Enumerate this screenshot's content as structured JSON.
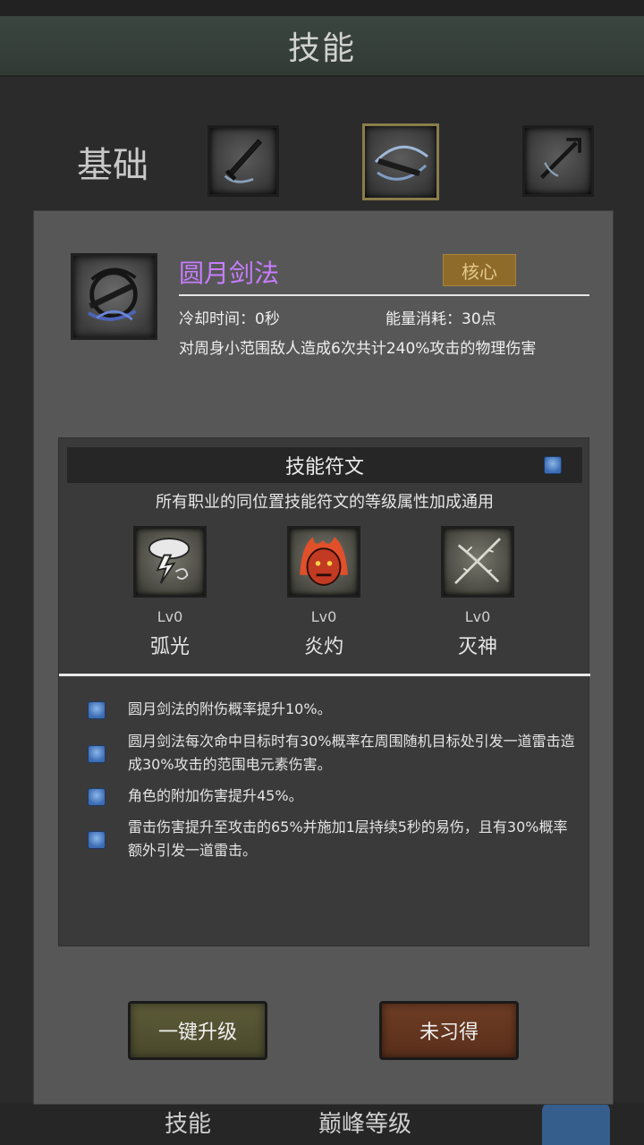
{
  "header": {
    "title": "技能"
  },
  "category": {
    "label": "基础"
  },
  "top_slots": [
    {
      "icon": "dagger-slash-icon",
      "selected": false
    },
    {
      "icon": "crescent-sword-icon",
      "selected": true
    },
    {
      "icon": "trident-spear-icon",
      "selected": false
    }
  ],
  "skill": {
    "name": "圆月剑法",
    "badge": "核心",
    "cooldown": "冷却时间：0秒",
    "energy": "能量消耗：30点",
    "description": "对周身小范围敌人造成6次共计240%攻击的物理伤害",
    "name_color": "#c77dff"
  },
  "runes": {
    "title": "技能符文",
    "subtitle": "所有职业的同位置技能符文的等级属性加成通用",
    "items": [
      {
        "icon": "storm-cloud-icon",
        "level": "Lv0",
        "name": "弧光"
      },
      {
        "icon": "fire-demon-icon",
        "level": "Lv0",
        "name": "炎灼"
      },
      {
        "icon": "thorn-vine-icon",
        "level": "Lv0",
        "name": "灭神"
      }
    ],
    "effects": [
      "圆月剑法的附伤概率提升10%。",
      "圆月剑法每次命中目标时有30%概率在周围随机目标处引发一道雷击造成30%攻击的范围电元素伤害。",
      "角色的附加伤害提升45%。",
      "雷击伤害提升至攻击的65%并施加1层持续5秒的易伤，且有30%概率额外引发一道雷击。"
    ]
  },
  "buttons": {
    "upgrade": "一键升级",
    "unlearned": "未习得"
  },
  "bottom_nav": {
    "skill": "技能",
    "peak_level": "巅峰等级"
  }
}
